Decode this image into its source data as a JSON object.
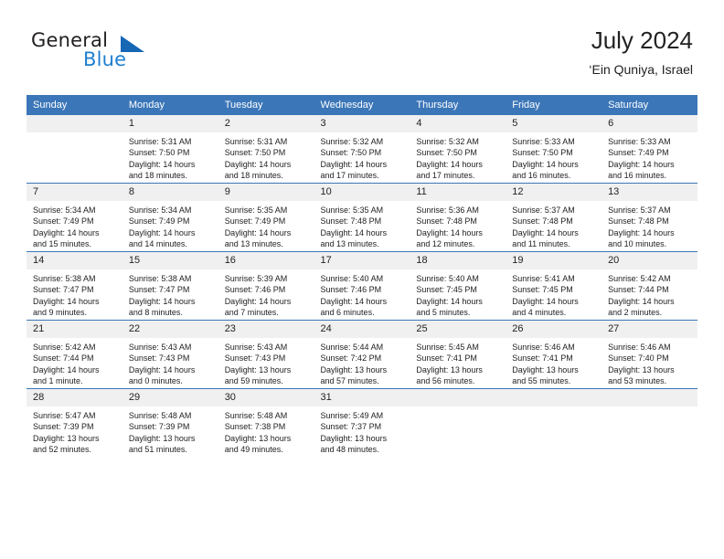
{
  "brand": {
    "word1": "General",
    "word2": "Blue",
    "logo_icon": "triangle-logo-icon"
  },
  "header": {
    "title": "July 2024",
    "subtitle": "‘Ein Quniya, Israel"
  },
  "colors": {
    "header_blue": "#3b76b8",
    "daynum_gray": "#f0f0f0",
    "brand_blue": "#1e7fd0",
    "text": "#222222"
  },
  "calendar": {
    "weekday_headers": [
      "Sunday",
      "Monday",
      "Tuesday",
      "Wednesday",
      "Thursday",
      "Friday",
      "Saturday"
    ],
    "weeks": [
      [
        {
          "day": "",
          "blank": true
        },
        {
          "day": "1",
          "sunrise": "Sunrise: 5:31 AM",
          "sunset": "Sunset: 7:50 PM",
          "daylight1": "Daylight: 14 hours",
          "daylight2": "and 18 minutes."
        },
        {
          "day": "2",
          "sunrise": "Sunrise: 5:31 AM",
          "sunset": "Sunset: 7:50 PM",
          "daylight1": "Daylight: 14 hours",
          "daylight2": "and 18 minutes."
        },
        {
          "day": "3",
          "sunrise": "Sunrise: 5:32 AM",
          "sunset": "Sunset: 7:50 PM",
          "daylight1": "Daylight: 14 hours",
          "daylight2": "and 17 minutes."
        },
        {
          "day": "4",
          "sunrise": "Sunrise: 5:32 AM",
          "sunset": "Sunset: 7:50 PM",
          "daylight1": "Daylight: 14 hours",
          "daylight2": "and 17 minutes."
        },
        {
          "day": "5",
          "sunrise": "Sunrise: 5:33 AM",
          "sunset": "Sunset: 7:50 PM",
          "daylight1": "Daylight: 14 hours",
          "daylight2": "and 16 minutes."
        },
        {
          "day": "6",
          "sunrise": "Sunrise: 5:33 AM",
          "sunset": "Sunset: 7:49 PM",
          "daylight1": "Daylight: 14 hours",
          "daylight2": "and 16 minutes."
        }
      ],
      [
        {
          "day": "7",
          "sunrise": "Sunrise: 5:34 AM",
          "sunset": "Sunset: 7:49 PM",
          "daylight1": "Daylight: 14 hours",
          "daylight2": "and 15 minutes."
        },
        {
          "day": "8",
          "sunrise": "Sunrise: 5:34 AM",
          "sunset": "Sunset: 7:49 PM",
          "daylight1": "Daylight: 14 hours",
          "daylight2": "and 14 minutes."
        },
        {
          "day": "9",
          "sunrise": "Sunrise: 5:35 AM",
          "sunset": "Sunset: 7:49 PM",
          "daylight1": "Daylight: 14 hours",
          "daylight2": "and 13 minutes."
        },
        {
          "day": "10",
          "sunrise": "Sunrise: 5:35 AM",
          "sunset": "Sunset: 7:48 PM",
          "daylight1": "Daylight: 14 hours",
          "daylight2": "and 13 minutes."
        },
        {
          "day": "11",
          "sunrise": "Sunrise: 5:36 AM",
          "sunset": "Sunset: 7:48 PM",
          "daylight1": "Daylight: 14 hours",
          "daylight2": "and 12 minutes."
        },
        {
          "day": "12",
          "sunrise": "Sunrise: 5:37 AM",
          "sunset": "Sunset: 7:48 PM",
          "daylight1": "Daylight: 14 hours",
          "daylight2": "and 11 minutes."
        },
        {
          "day": "13",
          "sunrise": "Sunrise: 5:37 AM",
          "sunset": "Sunset: 7:48 PM",
          "daylight1": "Daylight: 14 hours",
          "daylight2": "and 10 minutes."
        }
      ],
      [
        {
          "day": "14",
          "sunrise": "Sunrise: 5:38 AM",
          "sunset": "Sunset: 7:47 PM",
          "daylight1": "Daylight: 14 hours",
          "daylight2": "and 9 minutes."
        },
        {
          "day": "15",
          "sunrise": "Sunrise: 5:38 AM",
          "sunset": "Sunset: 7:47 PM",
          "daylight1": "Daylight: 14 hours",
          "daylight2": "and 8 minutes."
        },
        {
          "day": "16",
          "sunrise": "Sunrise: 5:39 AM",
          "sunset": "Sunset: 7:46 PM",
          "daylight1": "Daylight: 14 hours",
          "daylight2": "and 7 minutes."
        },
        {
          "day": "17",
          "sunrise": "Sunrise: 5:40 AM",
          "sunset": "Sunset: 7:46 PM",
          "daylight1": "Daylight: 14 hours",
          "daylight2": "and 6 minutes."
        },
        {
          "day": "18",
          "sunrise": "Sunrise: 5:40 AM",
          "sunset": "Sunset: 7:45 PM",
          "daylight1": "Daylight: 14 hours",
          "daylight2": "and 5 minutes."
        },
        {
          "day": "19",
          "sunrise": "Sunrise: 5:41 AM",
          "sunset": "Sunset: 7:45 PM",
          "daylight1": "Daylight: 14 hours",
          "daylight2": "and 4 minutes."
        },
        {
          "day": "20",
          "sunrise": "Sunrise: 5:42 AM",
          "sunset": "Sunset: 7:44 PM",
          "daylight1": "Daylight: 14 hours",
          "daylight2": "and 2 minutes."
        }
      ],
      [
        {
          "day": "21",
          "sunrise": "Sunrise: 5:42 AM",
          "sunset": "Sunset: 7:44 PM",
          "daylight1": "Daylight: 14 hours",
          "daylight2": "and 1 minute."
        },
        {
          "day": "22",
          "sunrise": "Sunrise: 5:43 AM",
          "sunset": "Sunset: 7:43 PM",
          "daylight1": "Daylight: 14 hours",
          "daylight2": "and 0 minutes."
        },
        {
          "day": "23",
          "sunrise": "Sunrise: 5:43 AM",
          "sunset": "Sunset: 7:43 PM",
          "daylight1": "Daylight: 13 hours",
          "daylight2": "and 59 minutes."
        },
        {
          "day": "24",
          "sunrise": "Sunrise: 5:44 AM",
          "sunset": "Sunset: 7:42 PM",
          "daylight1": "Daylight: 13 hours",
          "daylight2": "and 57 minutes."
        },
        {
          "day": "25",
          "sunrise": "Sunrise: 5:45 AM",
          "sunset": "Sunset: 7:41 PM",
          "daylight1": "Daylight: 13 hours",
          "daylight2": "and 56 minutes."
        },
        {
          "day": "26",
          "sunrise": "Sunrise: 5:46 AM",
          "sunset": "Sunset: 7:41 PM",
          "daylight1": "Daylight: 13 hours",
          "daylight2": "and 55 minutes."
        },
        {
          "day": "27",
          "sunrise": "Sunrise: 5:46 AM",
          "sunset": "Sunset: 7:40 PM",
          "daylight1": "Daylight: 13 hours",
          "daylight2": "and 53 minutes."
        }
      ],
      [
        {
          "day": "28",
          "sunrise": "Sunrise: 5:47 AM",
          "sunset": "Sunset: 7:39 PM",
          "daylight1": "Daylight: 13 hours",
          "daylight2": "and 52 minutes."
        },
        {
          "day": "29",
          "sunrise": "Sunrise: 5:48 AM",
          "sunset": "Sunset: 7:39 PM",
          "daylight1": "Daylight: 13 hours",
          "daylight2": "and 51 minutes."
        },
        {
          "day": "30",
          "sunrise": "Sunrise: 5:48 AM",
          "sunset": "Sunset: 7:38 PM",
          "daylight1": "Daylight: 13 hours",
          "daylight2": "and 49 minutes."
        },
        {
          "day": "31",
          "sunrise": "Sunrise: 5:49 AM",
          "sunset": "Sunset: 7:37 PM",
          "daylight1": "Daylight: 13 hours",
          "daylight2": "and 48 minutes."
        },
        {
          "day": "",
          "blank": true
        },
        {
          "day": "",
          "blank": true
        },
        {
          "day": "",
          "blank": true
        }
      ]
    ]
  }
}
